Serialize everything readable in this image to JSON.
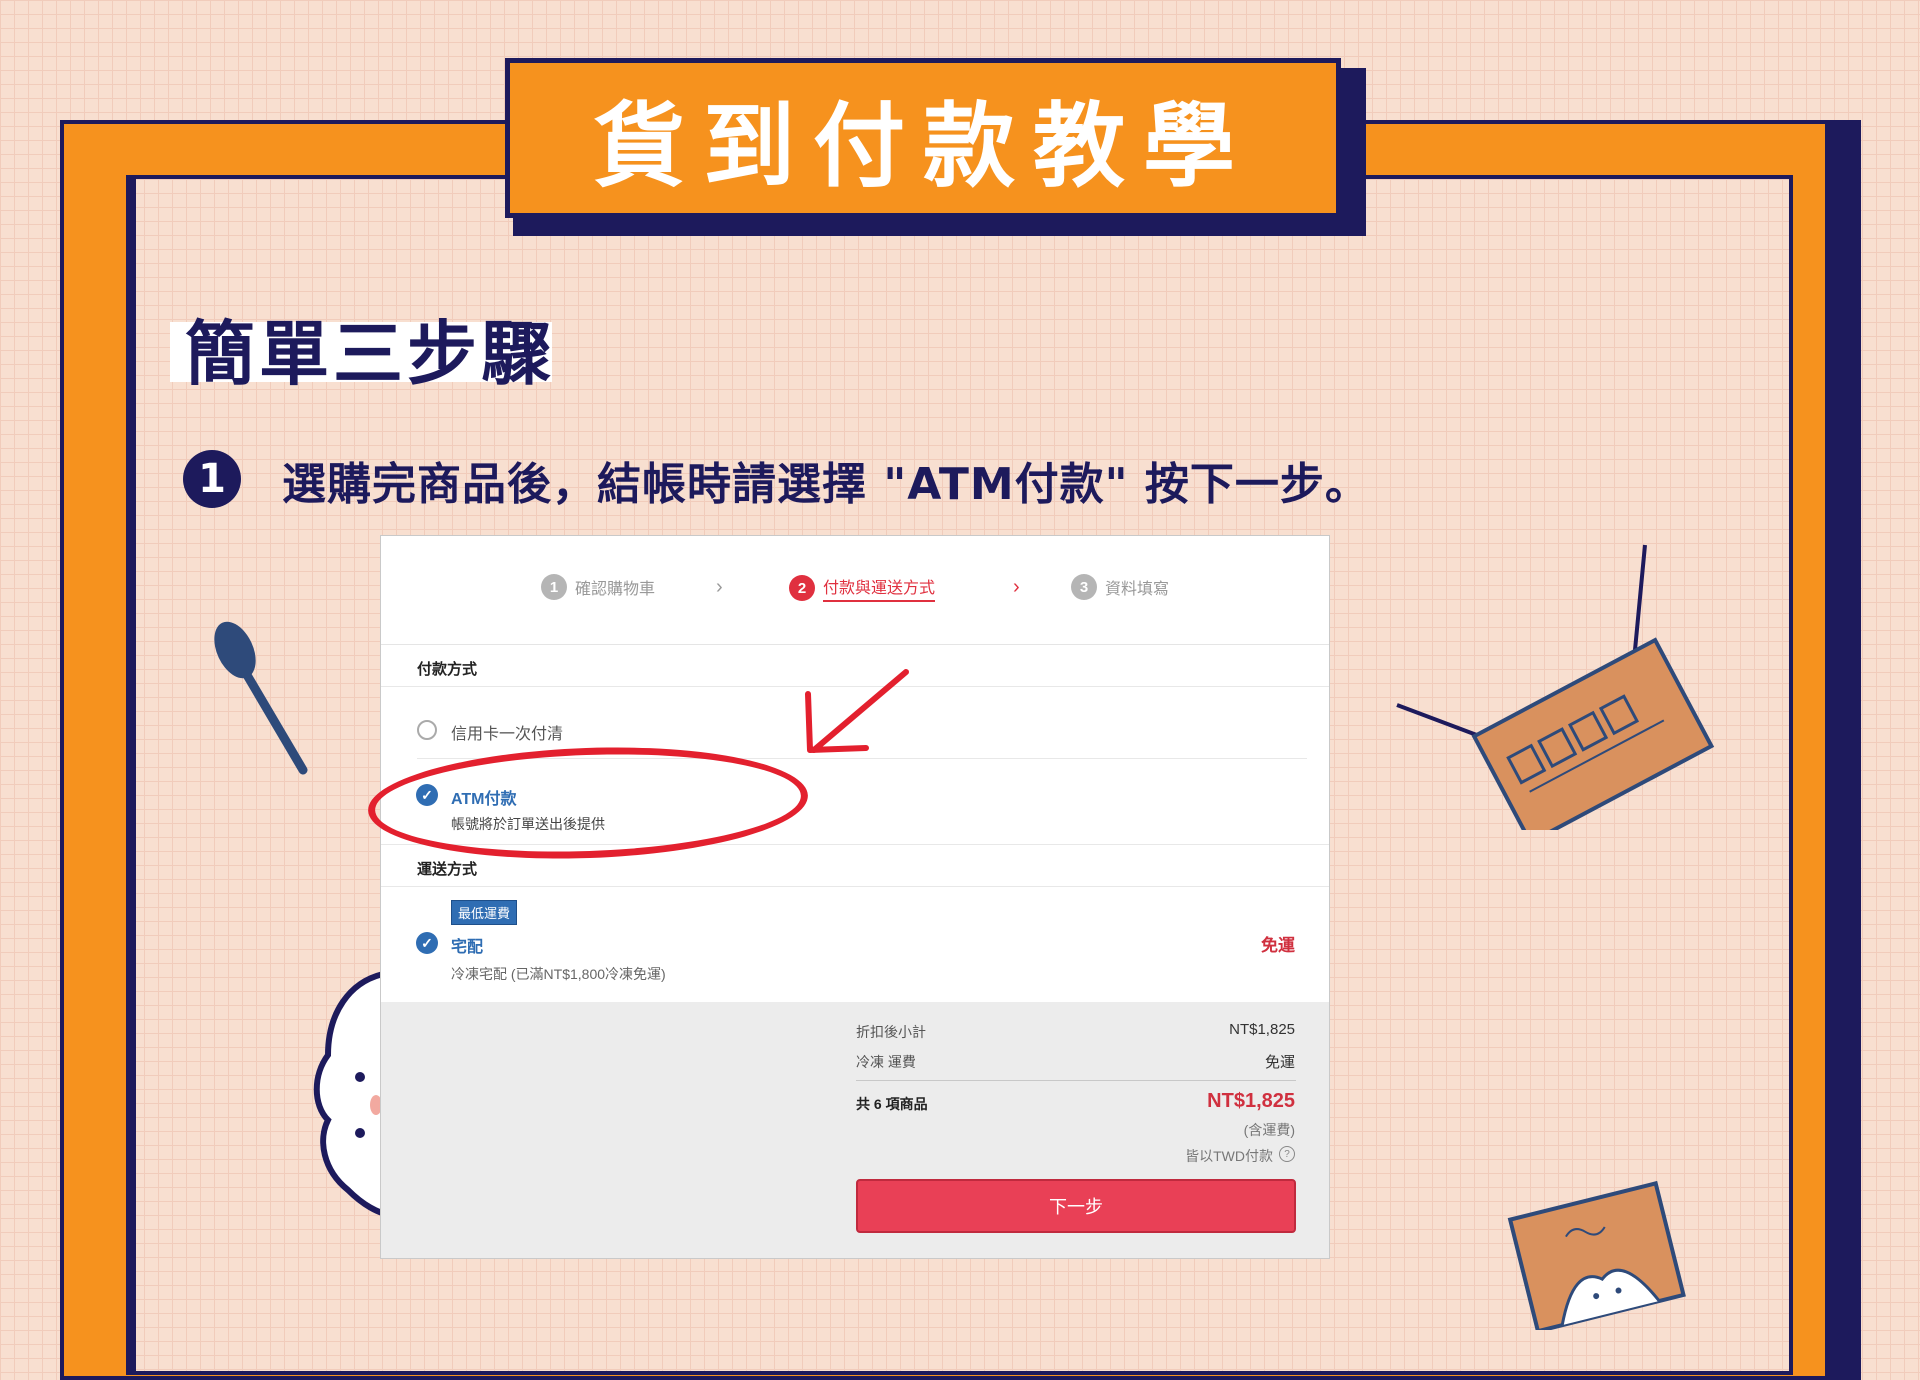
{
  "banner": {
    "title": "貨到付款教學"
  },
  "heading": "簡單三步驟",
  "step": {
    "number": "1",
    "text": "選購完商品後，結帳時請選擇 \"ATM付款\" 按下一步。"
  },
  "checkout": {
    "progress": [
      {
        "num": "1",
        "label": "確認購物車"
      },
      {
        "num": "2",
        "label": "付款與運送方式"
      },
      {
        "num": "3",
        "label": "資料填寫"
      }
    ],
    "payment_title": "付款方式",
    "payment_options": [
      {
        "label": "信用卡一次付清",
        "selected": false
      },
      {
        "label": "ATM付款",
        "sub": "帳號將於訂單送出後提供",
        "selected": true
      }
    ],
    "shipping_title": "運送方式",
    "shipping_badge": "最低運費",
    "shipping_option": {
      "label": "宅配",
      "sub": "冷凍宅配 (已滿NT$1,800冷凍免運)",
      "price": "免運"
    },
    "summary": {
      "subtotal_label": "折扣後小計",
      "subtotal_value": "NT$1,825",
      "shipping_label": "冷凍 運費",
      "shipping_value": "免運",
      "items_label": "共 6 項商品",
      "total_value": "NT$1,825",
      "tax_note": "(含運費)",
      "currency_note": "皆以TWD付款"
    },
    "next_button": "下一步"
  },
  "colors": {
    "orange": "#f6921e",
    "navy": "#1d1a5c",
    "red": "#e94056",
    "blue": "#2f6db3"
  }
}
